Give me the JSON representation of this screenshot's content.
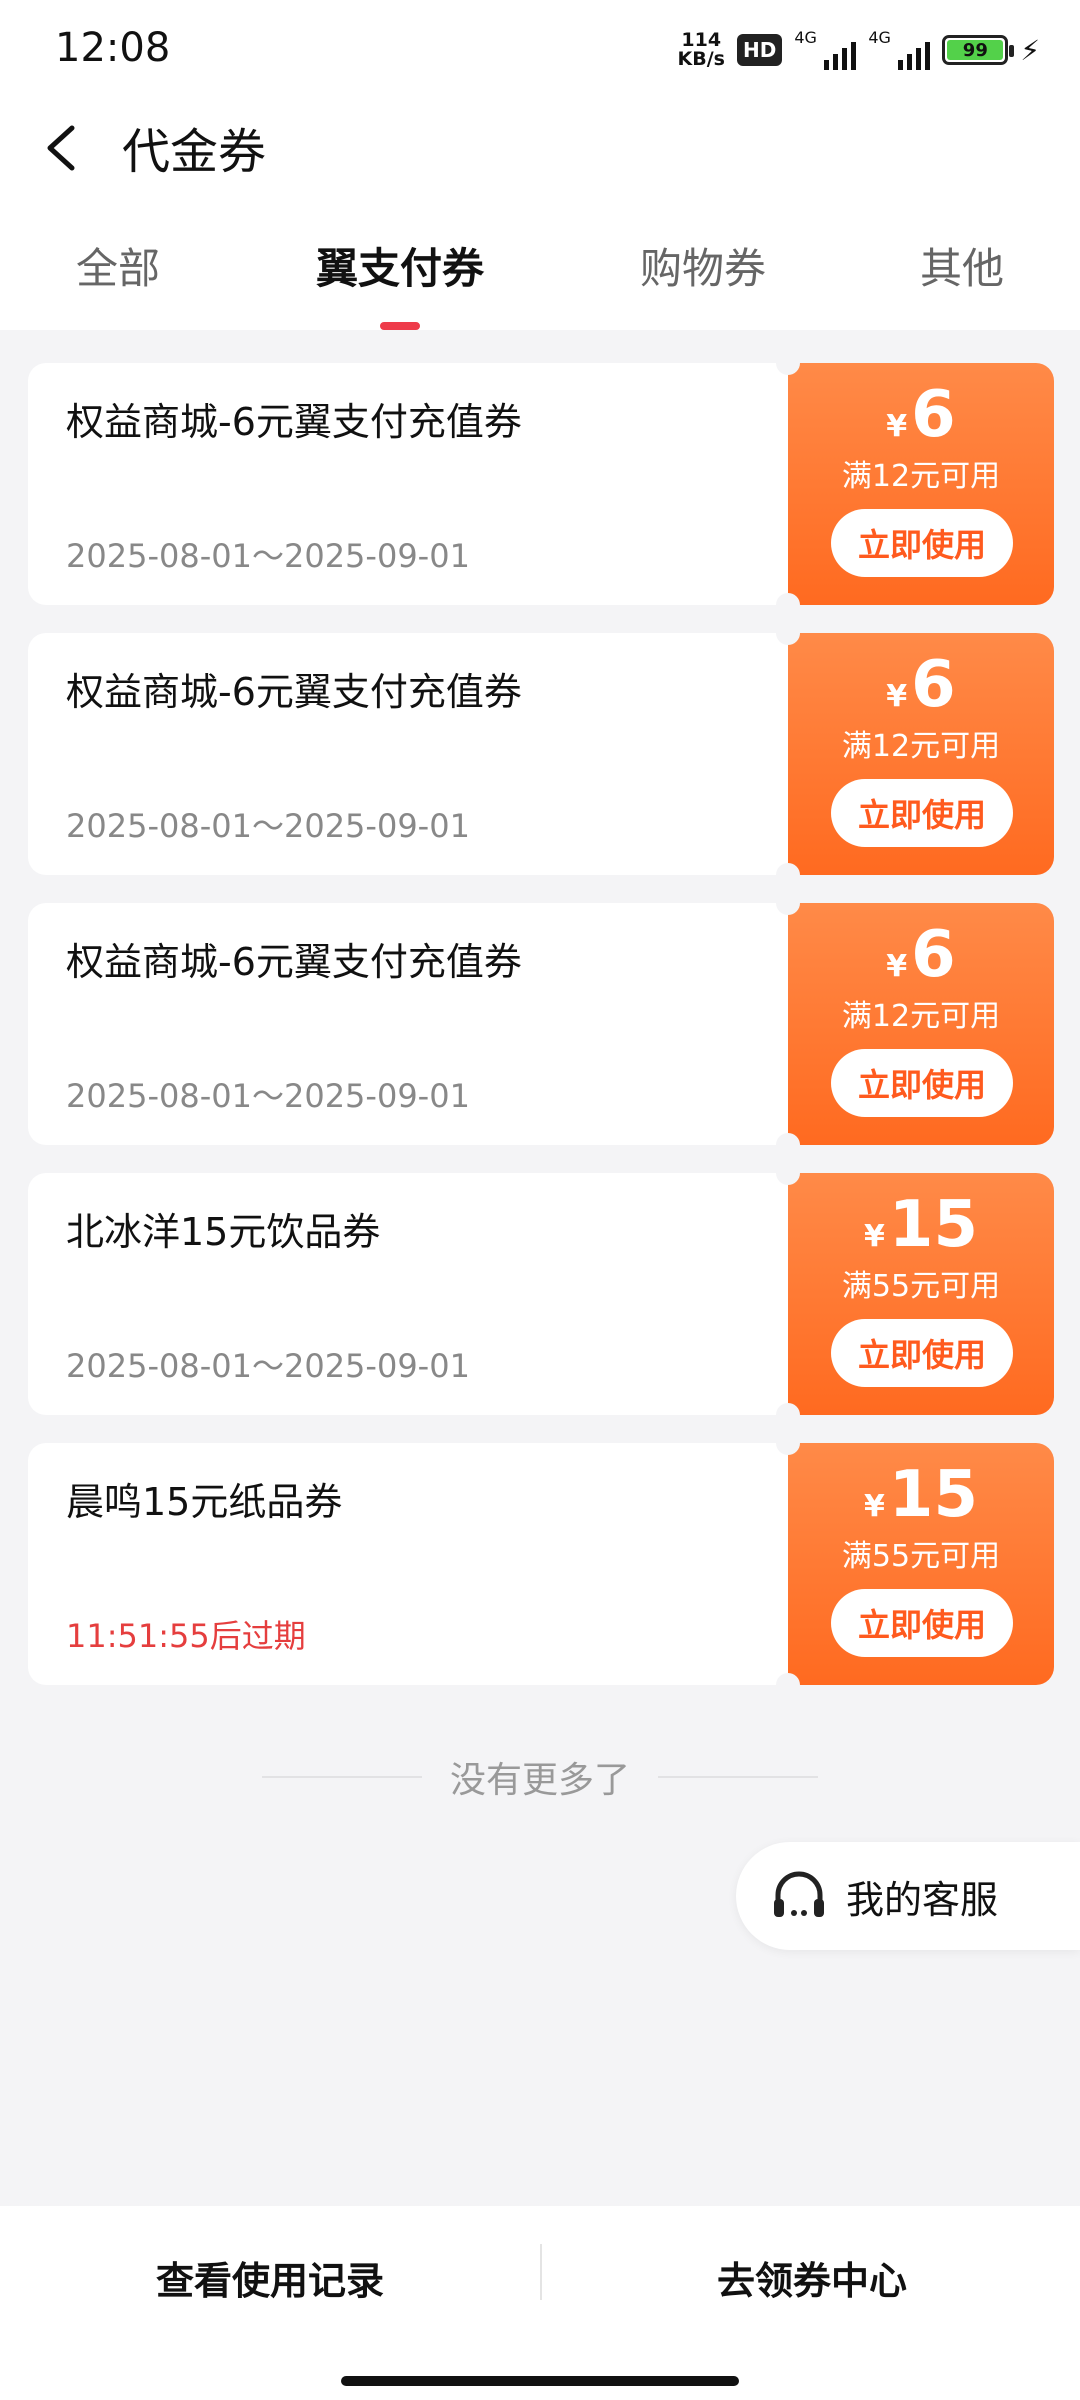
{
  "status_bar": {
    "time": "12:08",
    "net_speed_value": "114",
    "net_speed_unit": "KB/s",
    "hd_label": "HD",
    "signal1_label": "4G",
    "signal2_label": "4G",
    "battery": "99"
  },
  "header": {
    "title": "代金券"
  },
  "tabs": [
    {
      "label": "全部"
    },
    {
      "label": "翼支付券"
    },
    {
      "label": "购物券"
    },
    {
      "label": "其他"
    }
  ],
  "active_tab": "翼支付券",
  "coupons": [
    {
      "name": "权益商城-6元翼支付充值券",
      "date": "2025-08-01～2025-09-01",
      "currency": "¥",
      "amount": "6",
      "condition": "满12元可用",
      "button": "立即使用"
    },
    {
      "name": "权益商城-6元翼支付充值券",
      "date": "2025-08-01～2025-09-01",
      "currency": "¥",
      "amount": "6",
      "condition": "满12元可用",
      "button": "立即使用"
    },
    {
      "name": "权益商城-6元翼支付充值券",
      "date": "2025-08-01～2025-09-01",
      "currency": "¥",
      "amount": "6",
      "condition": "满12元可用",
      "button": "立即使用"
    },
    {
      "name": "北冰洋15元饮品券",
      "date": "2025-08-01～2025-09-01",
      "currency": "¥",
      "amount": "15",
      "condition": "满55元可用",
      "button": "立即使用"
    },
    {
      "name": "晨鸣15元纸品券",
      "date": "11:51:55后过期",
      "currency": "¥",
      "amount": "15",
      "condition": "满55元可用",
      "button": "立即使用"
    }
  ],
  "no_more": "没有更多了",
  "service": {
    "label": "我的客服",
    "icon": "headset-icon"
  },
  "bottom_bar": {
    "left": "查看使用记录",
    "right": "去领券中心"
  },
  "colors": {
    "accent": "#ee3b4a",
    "coupon_orange": "#ff6a20",
    "expire_red": "#e53e3e"
  }
}
